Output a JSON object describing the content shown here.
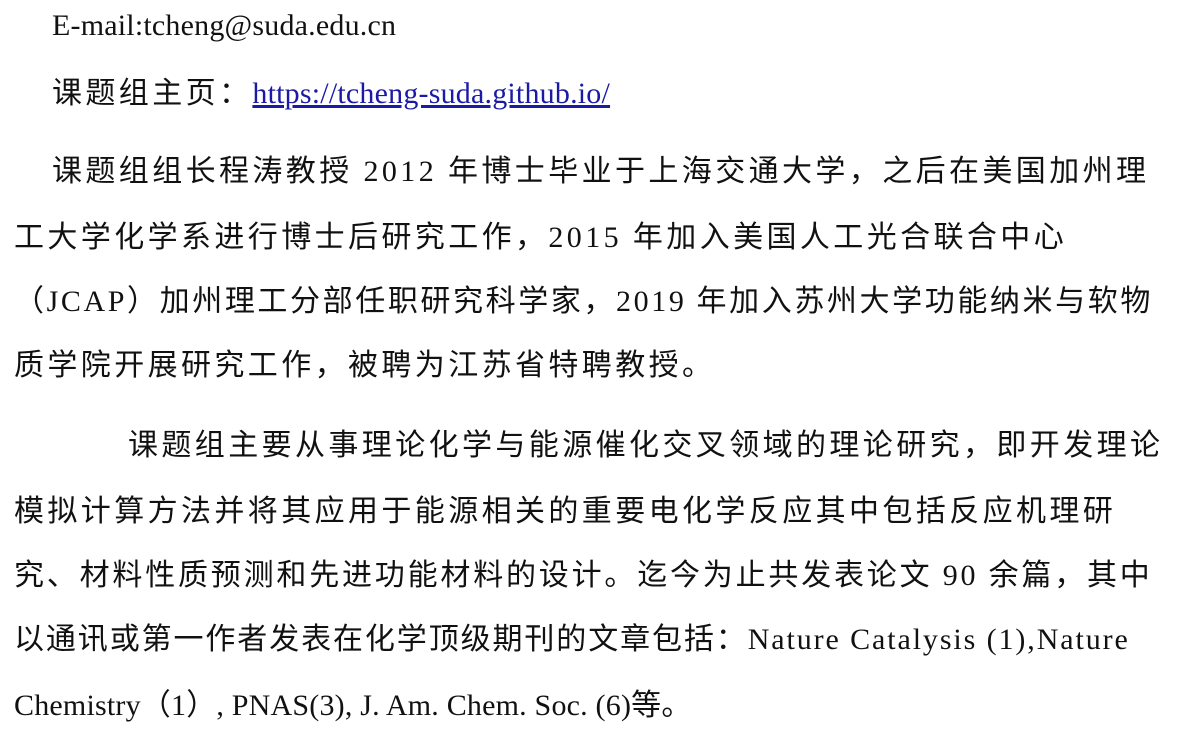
{
  "contact": {
    "email_line": "E-mail:tcheng@suda.edu.cn",
    "homepage_label": "课题组主页：",
    "homepage_url": "https://tcheng-suda.github.io/"
  },
  "bio": {
    "lines": [
      "课题组组长程涛教授 2012 年博士毕业于上海交通大学，之后在美国加州理",
      "工大学化学系进行博士后研究工作，2015 年加入美国人工光合联合中心",
      "（JCAP）加州理工分部任职研究科学家，2019 年加入苏州大学功能纳米与软物",
      "质学院开展研究工作，被聘为江苏省特聘教授。"
    ]
  },
  "research": {
    "lines": [
      "课题组主要从事理论化学与能源催化交叉领域的理论研究，即开发理论",
      "模拟计算方法并将其应用于能源相关的重要电化学反应其中包括反应机理研",
      "究、材料性质预测和先进功能材料的设计。迄今为止共发表论文 90 余篇，其中",
      "以通讯或第一作者发表在化学顶级期刊的文章包括：Nature Catalysis (1),Nature",
      "Chemistry（1）, PNAS(3), J. Am. Chem. Soc. (6)等。"
    ]
  }
}
